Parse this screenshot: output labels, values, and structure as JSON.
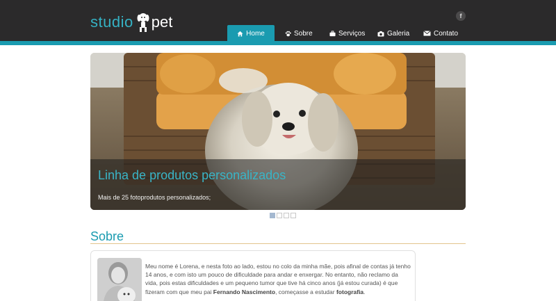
{
  "brand": {
    "logo_word1": "studio",
    "logo_word2": "pet",
    "accent_color": "#1a9bb0",
    "header_color": "#2b2a2b"
  },
  "social": {
    "facebook_label": "f",
    "icon": "facebook-icon"
  },
  "nav": {
    "items": [
      {
        "label": "Home",
        "icon": "home-icon",
        "active": true
      },
      {
        "label": "Sobre",
        "icon": "paw-icon",
        "active": false
      },
      {
        "label": "Serviços",
        "icon": "briefcase-icon",
        "active": false
      },
      {
        "label": "Galeria",
        "icon": "camera-icon",
        "active": false
      },
      {
        "label": "Contato",
        "icon": "envelope-icon",
        "active": false
      }
    ]
  },
  "slider": {
    "caption_title": "Linha de produtos personalizados",
    "caption_text": "Mais de 25 fotoprodutos personalizados;",
    "slide_count": 4,
    "active_index": 0
  },
  "about": {
    "title": "Sobre",
    "text_part1": "Meu nome é Lorena, e nesta foto ao lado, estou no colo da minha mãe, pois afinal de contas já tenho 14 anos, e com isto um pouco de dificuldade para andar e enxergar. No entanto, não reclamo da vida, pois estas dificuldades e um pequeno tumor que tive há cinco anos (já estou curada) é que fizeram com que meu pai ",
    "text_bold1": "Fernando Nascimento",
    "text_part2": ", começasse a estudar ",
    "text_bold2": "fotografia",
    "text_part3": "."
  }
}
